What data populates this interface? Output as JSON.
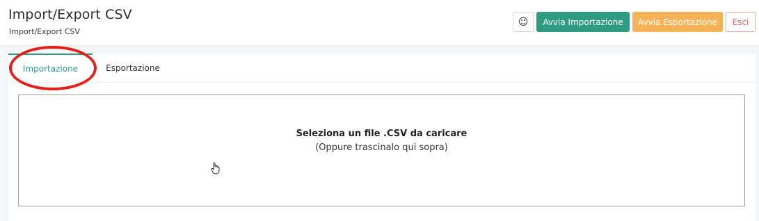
{
  "header": {
    "title": "Import/Export CSV",
    "subtitle": "Import/Export CSV"
  },
  "toolbar": {
    "icon_button": "smiley-icon",
    "import_label": "Avvia Importazione",
    "export_label": "Avvia Esportazione",
    "exit_label": "Esci"
  },
  "tabs": [
    {
      "label": "Importazione",
      "active": true
    },
    {
      "label": "Esportazione",
      "active": false
    }
  ],
  "dropzone": {
    "title": "Seleziona un file .CSV da caricare",
    "subtitle": "(Oppure trascinalo qui sopra)"
  },
  "colors": {
    "primary": "#2f9b81",
    "warning": "#f5b257",
    "danger": "#e06a6a",
    "annotation": "#e3201b"
  }
}
